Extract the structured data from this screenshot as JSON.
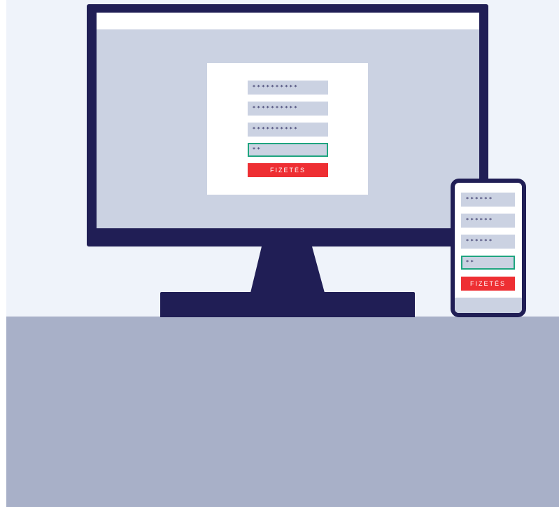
{
  "desktop": {
    "fields": [
      "**********",
      "**********",
      "**********"
    ],
    "cvv": "**",
    "pay_label": "FIZETÉS"
  },
  "mobile": {
    "fields": [
      "******",
      "******",
      "******"
    ],
    "cvv": "**",
    "pay_label": "FIZETÉS"
  },
  "colors": {
    "navy": "#201e55",
    "screen": "#cbd2e2",
    "pay_button": "#ee2f33",
    "cvv_border": "#1fa57f",
    "desk": "#a8b0c8",
    "wall": "#eff3fa"
  }
}
